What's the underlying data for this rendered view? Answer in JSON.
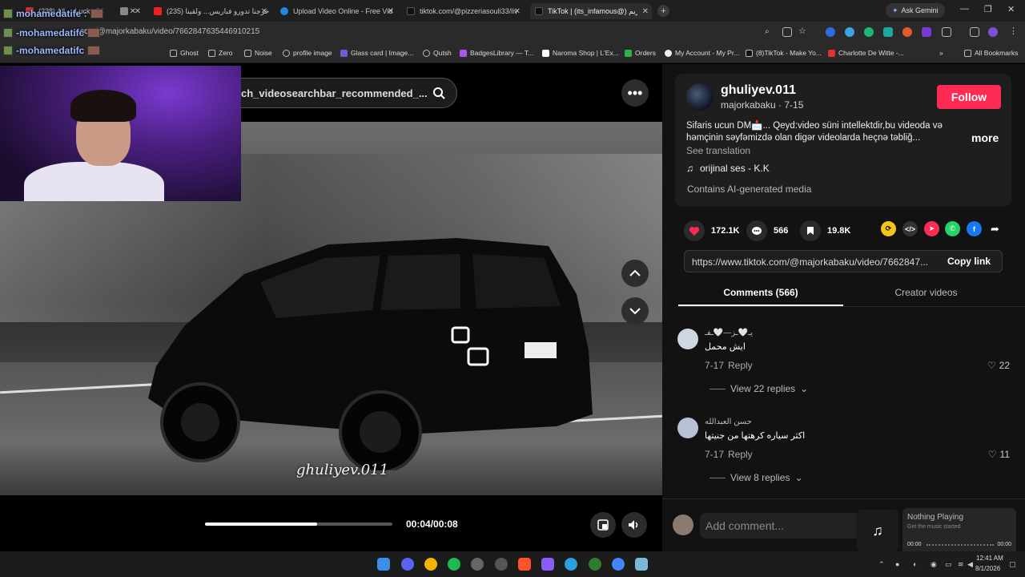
{
  "browser": {
    "tabs": [
      {
        "title": "(338) All ... Lucky 24",
        "fav": "#c33"
      },
      {
        "title": "",
        "fav": "#888"
      },
      {
        "title": "(235) خرجنا تدورو فباريس... ولقينا",
        "fav": "#e22"
      },
      {
        "title": "Upload Video Online - Free Vid",
        "fav": "#1e88e5"
      },
      {
        "title": "tiktok.com/@pizzeriasouli33/liv",
        "fav": "#111"
      },
      {
        "title": "TikTok | (its_infamous@) گریم",
        "fav": "#111"
      }
    ],
    "ask_gemini": "Ask Gemini",
    "url_host": "com",
    "url_path": "/@majorkabaku/video/7662847635446910215",
    "bookmarks": [
      "Ghost",
      "Zero",
      "Noise",
      "profile image",
      "Glass card | Image...",
      "Qutsh",
      "BadgesLibrary — T...",
      "Naroma Shop | L'Ex...",
      "Orders",
      "My Account - My Pr...",
      "(8)TikTok - Make Yo...",
      "Charlotte De Witte -..."
    ],
    "all_bookmarks": "All Bookmarks"
  },
  "overlay": {
    "names": [
      "mohamedatife :",
      "-mohamedatifc",
      "-mohamedatifc"
    ]
  },
  "player": {
    "search_text": "ch_videosearchbar_recommended_...",
    "watermark": "ghuliyev.011",
    "time": "00:04/00:08",
    "progress": 0.6
  },
  "post": {
    "username": "ghuliyev.011",
    "subline": "majorkabaku · 7-15",
    "follow_label": "Follow",
    "description": "Sifaris ucun DM📩... Qeyd:video süni intellektdir,bu videoda və həmçinin səyfəmizdə olan digər videolarda heçnə təbliğ...",
    "more_label": "more",
    "see_translation": "See translation",
    "sound": "orijinal ses - K.K",
    "ai_label": "Contains AI-generated media",
    "likes": "172.1K",
    "comments": "566",
    "saves": "19.8K",
    "link": "https://www.tiktok.com/@majorkabaku/video/7662847...",
    "copy_link": "Copy link",
    "colors": {
      "follow": "#fe2c55",
      "like": "#fe2c55"
    }
  },
  "tabs": {
    "comments": "Comments (566)",
    "creator": "Creator videos"
  },
  "comments": [
    {
      "name": "يـ🤍ـز—🤍ـفـ",
      "text": "ايش محمل",
      "date": "7-17",
      "reply": "Reply",
      "likes": "22",
      "replies": "View 22 replies"
    },
    {
      "name": "حسن العبدالله",
      "text": "اكثر سياره كرهتها من جنيتها",
      "date": "7-17",
      "reply": "Reply",
      "likes": "11",
      "replies": "View 8 replies"
    }
  ],
  "composer": {
    "placeholder": "Add comment..."
  },
  "media_widget": {
    "title": "Nothing Playing",
    "subtitle": "Get the music started",
    "start": "00:00",
    "end": "00:00"
  },
  "taskbar": {
    "time": "12:41 AM",
    "date": "8/1/2026"
  }
}
